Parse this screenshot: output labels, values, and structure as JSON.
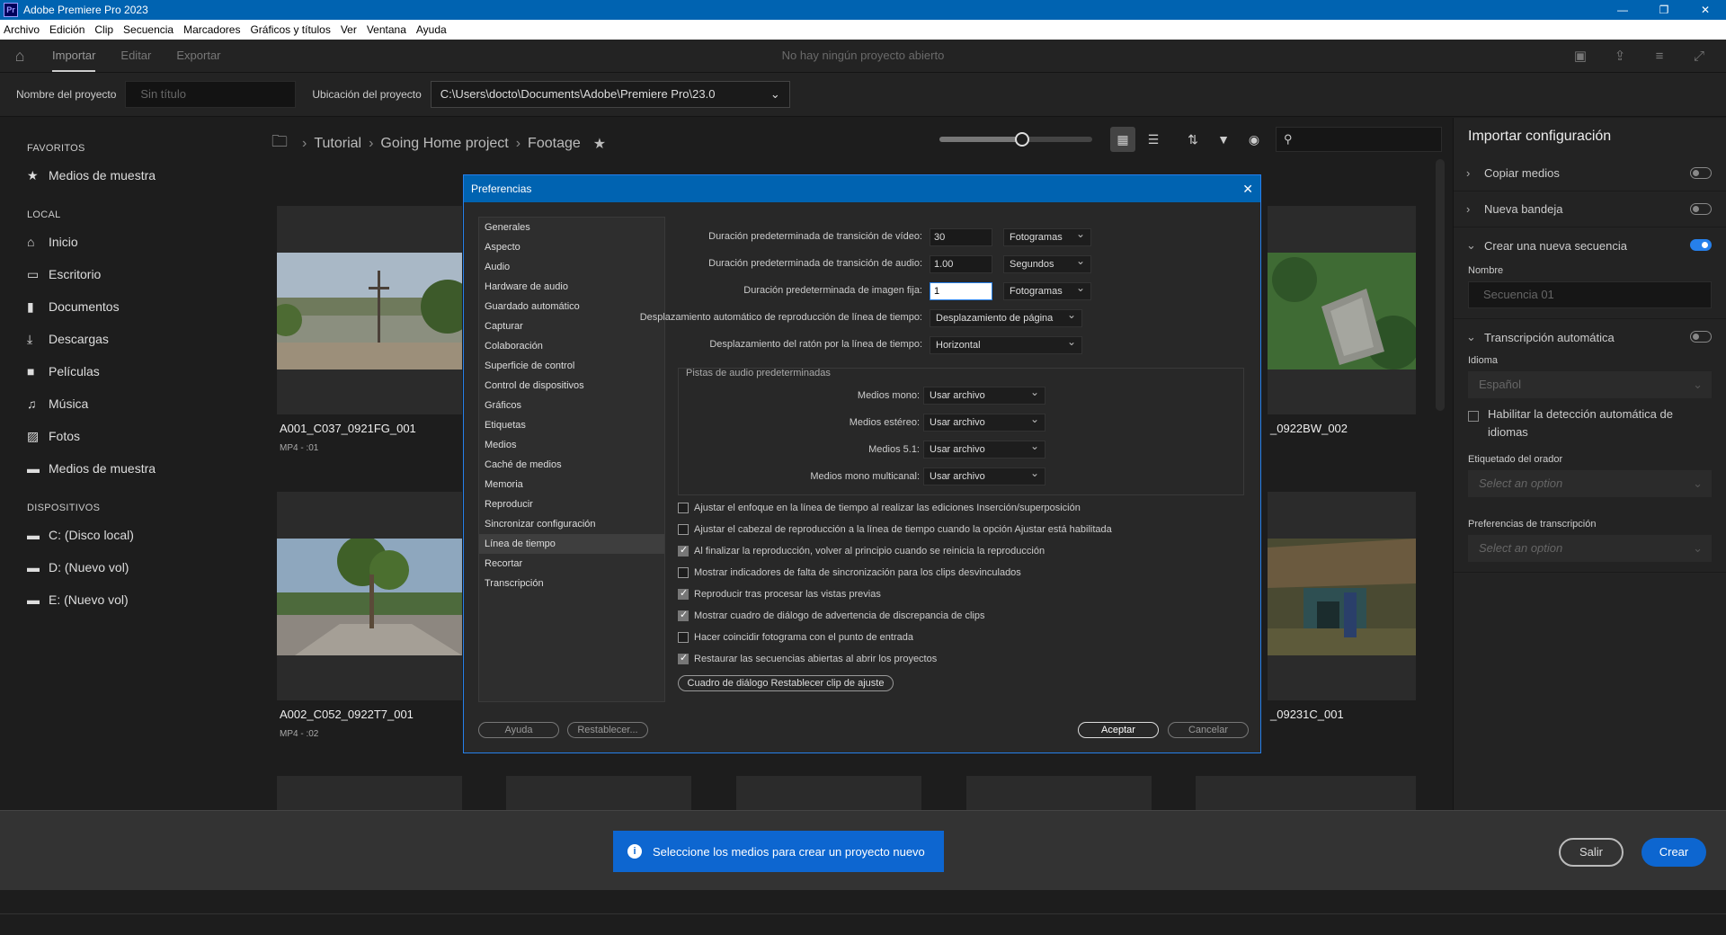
{
  "titlebar": {
    "app_icon": "Pr",
    "title": "Adobe Premiere Pro 2023",
    "minimize": "—",
    "restore": "❐",
    "close": "✕"
  },
  "menu": [
    "Archivo",
    "Edición",
    "Clip",
    "Secuencia",
    "Marcadores",
    "Gráficos y títulos",
    "Ver",
    "Ventana",
    "Ayuda"
  ],
  "top": {
    "tabs": [
      "Importar",
      "Editar",
      "Exportar"
    ],
    "center_message": "No hay ningún proyecto abierto"
  },
  "project": {
    "name_label": "Nombre del proyecto",
    "name_placeholder": "Sin título",
    "location_label": "Ubicación del proyecto",
    "location_value": "C:\\Users\\docto\\Documents\\Adobe\\Premiere Pro\\23.0"
  },
  "sidebar": {
    "favorites_heading": "FAVORITOS",
    "favorites": [
      {
        "label": "Medios de muestra",
        "icon": "star-icon"
      }
    ],
    "local_heading": "LOCAL",
    "local": [
      {
        "label": "Inicio",
        "icon": "home-icon"
      },
      {
        "label": "Escritorio",
        "icon": "monitor-icon"
      },
      {
        "label": "Documentos",
        "icon": "document-icon"
      },
      {
        "label": "Descargas",
        "icon": "download-icon"
      },
      {
        "label": "Películas",
        "icon": "video-icon"
      },
      {
        "label": "Música",
        "icon": "music-icon"
      },
      {
        "label": "Fotos",
        "icon": "image-icon"
      },
      {
        "label": "Medios de muestra",
        "icon": "folder-icon"
      }
    ],
    "devices_heading": "DISPOSITIVOS",
    "devices": [
      {
        "label": "C: (Disco local)",
        "icon": "folder-icon"
      },
      {
        "label": "D: (Nuevo vol)",
        "icon": "folder-icon"
      },
      {
        "label": "E: (Nuevo vol)",
        "icon": "folder-icon"
      }
    ]
  },
  "browser": {
    "breadcrumb": [
      "Tutorial",
      "Going Home project",
      "Footage"
    ],
    "thumbnail_size_fraction": 0.54,
    "cards": [
      {
        "name": "A001_C037_0921FG_001",
        "meta": "MP4 - :01"
      },
      {
        "name": "_0922BW_002",
        "meta": ""
      },
      {
        "name": "A002_C052_0922T7_001",
        "meta": "MP4 - :02"
      },
      {
        "name": "_09231C_001",
        "meta": ""
      }
    ]
  },
  "right_panel": {
    "title": "Importar configuración",
    "copy_media": "Copiar medios",
    "new_bin": "Nueva bandeja",
    "new_sequence": "Crear una nueva secuencia",
    "name_label": "Nombre",
    "name_placeholder": "Secuencia 01",
    "auto_transcription": "Transcripción automática",
    "language_label": "Idioma",
    "language_value": "Español",
    "detect_languages": "Habilitar la detección automática de idiomas",
    "speaker_label": "Etiquetado del orador",
    "speaker_placeholder": "Select an option",
    "transcription_prefs_label": "Preferencias de transcripción",
    "transcription_prefs_placeholder": "Select an option"
  },
  "footer": {
    "toast": "Seleccione los medios para crear un proyecto nuevo",
    "exit": "Salir",
    "create": "Crear"
  },
  "dialog": {
    "title": "Preferencias",
    "categories": [
      "Generales",
      "Aspecto",
      "Audio",
      "Hardware de audio",
      "Guardado automático",
      "Capturar",
      "Colaboración",
      "Superficie de control",
      "Control de dispositivos",
      "Gráficos",
      "Etiquetas",
      "Medios",
      "Caché de medios",
      "Memoria",
      "Reproducir",
      "Sincronizar configuración",
      "Línea de tiempo",
      "Recortar",
      "Transcripción"
    ],
    "selected_category": "Línea de tiempo",
    "video_transition_label": "Duración predeterminada de transición de vídeo:",
    "video_transition_value": "30",
    "video_transition_unit": "Fotogramas",
    "audio_transition_label": "Duración predeterminada de transición de audio:",
    "audio_transition_value": "1.00",
    "audio_transition_unit": "Segundos",
    "still_label": "Duración predeterminada de imagen fija:",
    "still_value": "1",
    "still_unit": "Fotogramas",
    "autoscroll_label": "Desplazamiento automático de reproducción de línea de tiempo:",
    "autoscroll_value": "Desplazamiento de página",
    "mousescroll_label": "Desplazamiento del ratón por la línea de tiempo:",
    "mousescroll_value": "Horizontal",
    "audio_tracks_title": "Pistas de audio predeterminadas",
    "mono_label": "Medios mono:",
    "stereo_label": "Medios estéreo:",
    "five_one_label": "Medios 5.1:",
    "multichannel_label": "Medios mono multicanal:",
    "use_file": "Usar archivo",
    "checkboxes": [
      {
        "label": "Ajustar el enfoque en la línea de tiempo al realizar las ediciones Inserción/superposición",
        "checked": false
      },
      {
        "label": "Ajustar el cabezal de reproducción a la línea de tiempo cuando la opción Ajustar está habilitada",
        "checked": false
      },
      {
        "label": "Al finalizar la reproducción, volver al principio cuando se reinicia la reproducción",
        "checked": true
      },
      {
        "label": "Mostrar indicadores de falta de sincronización para los clips desvinculados",
        "checked": false
      },
      {
        "label": "Reproducir tras procesar las vistas previas",
        "checked": true
      },
      {
        "label": "Mostrar cuadro de diálogo de advertencia de discrepancia de clips",
        "checked": true
      },
      {
        "label": "Hacer coincidir fotograma con el punto de entrada",
        "checked": false
      },
      {
        "label": "Restaurar las secuencias abiertas al abrir los proyectos",
        "checked": true
      }
    ],
    "reset_clip_button": "Cuadro de diálogo Restablecer clip de ajuste",
    "help": "Ayuda",
    "reset": "Restablecer...",
    "ok": "Aceptar",
    "cancel": "Cancelar"
  }
}
